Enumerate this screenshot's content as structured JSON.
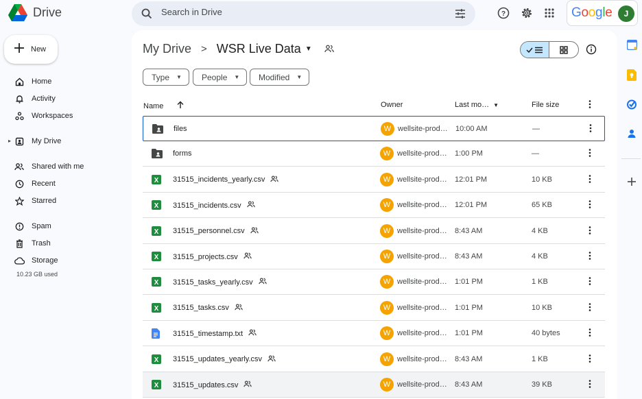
{
  "app": {
    "title": "Drive",
    "brand": "Google",
    "user_initial": "J"
  },
  "search": {
    "placeholder": "Search in Drive"
  },
  "sidebar": {
    "new_label": "New",
    "items": [
      {
        "label": "Home",
        "icon": "home-icon"
      },
      {
        "label": "Activity",
        "icon": "bell-icon"
      },
      {
        "label": "Workspaces",
        "icon": "workspaces-icon"
      },
      {
        "label": "My Drive",
        "icon": "my-drive-icon"
      },
      {
        "label": "Shared with me",
        "icon": "people-icon"
      },
      {
        "label": "Recent",
        "icon": "clock-icon"
      },
      {
        "label": "Starred",
        "icon": "star-icon"
      },
      {
        "label": "Spam",
        "icon": "spam-icon"
      },
      {
        "label": "Trash",
        "icon": "trash-icon"
      },
      {
        "label": "Storage",
        "icon": "cloud-icon"
      }
    ],
    "storage_used": "10.23 GB used"
  },
  "breadcrumb": {
    "parent": "My Drive",
    "current": "WSR Live Data"
  },
  "filters": [
    "Type",
    "People",
    "Modified"
  ],
  "columns": {
    "name": "Name",
    "owner": "Owner",
    "modified": "Last mo…",
    "size": "File size"
  },
  "files": [
    {
      "name": "files",
      "kind": "folder",
      "shared": false,
      "owner": "wellsite-prod…",
      "owner_initial": "W",
      "modified": "10:00 AM",
      "size": "—"
    },
    {
      "name": "forms",
      "kind": "folder",
      "shared": false,
      "owner": "wellsite-prod…",
      "owner_initial": "W",
      "modified": "1:00 PM",
      "size": "—"
    },
    {
      "name": "31515_incidents_yearly.csv",
      "kind": "sheet",
      "shared": true,
      "owner": "wellsite-prod…",
      "owner_initial": "W",
      "modified": "12:01 PM",
      "size": "10 KB"
    },
    {
      "name": "31515_incidents.csv",
      "kind": "sheet",
      "shared": true,
      "owner": "wellsite-prod…",
      "owner_initial": "W",
      "modified": "12:01 PM",
      "size": "65 KB"
    },
    {
      "name": "31515_personnel.csv",
      "kind": "sheet",
      "shared": true,
      "owner": "wellsite-prod…",
      "owner_initial": "W",
      "modified": "8:43 AM",
      "size": "4 KB"
    },
    {
      "name": "31515_projects.csv",
      "kind": "sheet",
      "shared": true,
      "owner": "wellsite-prod…",
      "owner_initial": "W",
      "modified": "8:43 AM",
      "size": "4 KB"
    },
    {
      "name": "31515_tasks_yearly.csv",
      "kind": "sheet",
      "shared": true,
      "owner": "wellsite-prod…",
      "owner_initial": "W",
      "modified": "1:01 PM",
      "size": "1 KB"
    },
    {
      "name": "31515_tasks.csv",
      "kind": "sheet",
      "shared": true,
      "owner": "wellsite-prod…",
      "owner_initial": "W",
      "modified": "1:01 PM",
      "size": "10 KB"
    },
    {
      "name": "31515_timestamp.txt",
      "kind": "doc",
      "shared": true,
      "owner": "wellsite-prod…",
      "owner_initial": "W",
      "modified": "1:01 PM",
      "size": "40 bytes"
    },
    {
      "name": "31515_updates_yearly.csv",
      "kind": "sheet",
      "shared": true,
      "owner": "wellsite-prod…",
      "owner_initial": "W",
      "modified": "8:43 AM",
      "size": "1 KB"
    },
    {
      "name": "31515_updates.csv",
      "kind": "sheet",
      "shared": true,
      "owner": "wellsite-prod…",
      "owner_initial": "W",
      "modified": "8:43 AM",
      "size": "39 KB"
    }
  ],
  "colors": {
    "accent": "#0b57d0",
    "selected_view": "#c2e7ff",
    "sheet_green": "#1e8e3e",
    "doc_blue": "#4285f4",
    "owner_avatar": "#f4a300"
  }
}
